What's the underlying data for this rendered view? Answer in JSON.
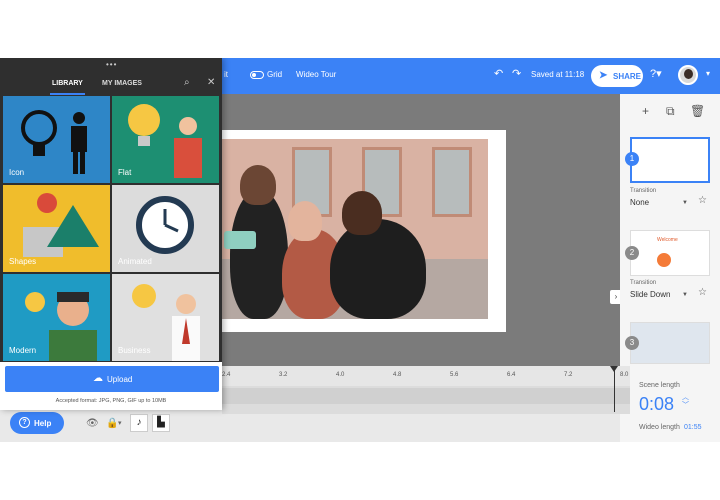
{
  "topbar": {
    "edit_fragment": "it",
    "grid_label": "Grid",
    "tour_label": "Wideo Tour",
    "saved_status": "Saved at 11:18",
    "share_label": "SHARE"
  },
  "library": {
    "tabs": [
      {
        "label": "LIBRARY",
        "active": true
      },
      {
        "label": "MY IMAGES",
        "active": false
      }
    ],
    "tiles": [
      {
        "name": "Icon"
      },
      {
        "name": "Flat"
      },
      {
        "name": "Shapes"
      },
      {
        "name": "Animated"
      },
      {
        "name": "Modern"
      },
      {
        "name": "Business"
      }
    ],
    "upload_label": "Upload",
    "formats_text": "Accepted format: JPG, PNG, GIF up to 10MB"
  },
  "right_panel": {
    "scenes": [
      {
        "number": "1",
        "transition_label": "Transition",
        "transition_value": "None"
      },
      {
        "number": "2",
        "transition_label": "Transition",
        "transition_value": "Slide Down",
        "thumb_title": "Welcome"
      },
      {
        "number": "3"
      }
    ]
  },
  "timeline": {
    "ticks": [
      "2.4",
      "3.2",
      "4.0",
      "4.8",
      "5.6",
      "6.4",
      "7.2",
      "8.0"
    ],
    "scene_length_label": "Scene length",
    "scene_length_value": "0:08",
    "wideo_length_label": "Wideo length",
    "wideo_length_value": "01:55"
  },
  "bottom": {
    "help_label": "Help"
  },
  "colors": {
    "accent": "#3b82f6",
    "panel_dark": "#2f2f2f"
  }
}
